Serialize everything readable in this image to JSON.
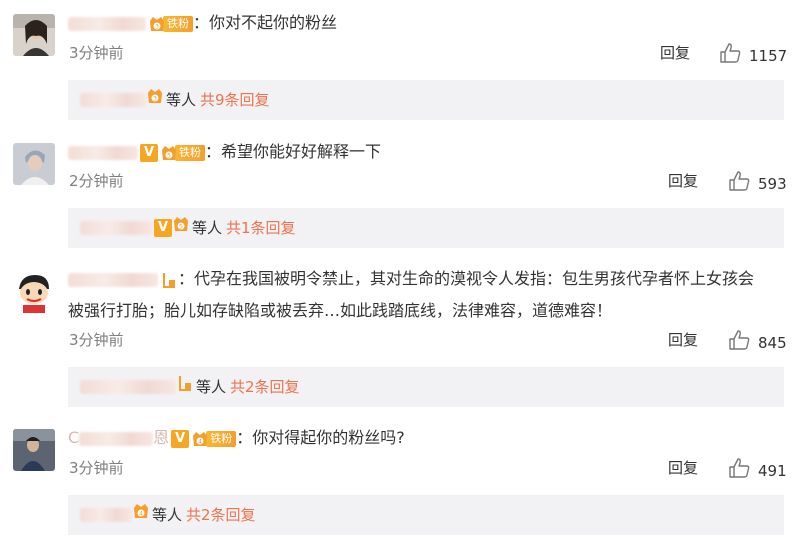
{
  "comments": [
    {
      "text": "：你对不起你的粉丝",
      "fan_tag": "铁粉",
      "time": "3分钟前",
      "reply_label": "回复",
      "likes": "1157",
      "sub_deng": "等人",
      "sub_count": "共9条回复"
    },
    {
      "text": "：希望你能好好解释一下",
      "fan_tag": "铁粉",
      "time": "2分钟前",
      "reply_label": "回复",
      "likes": "593",
      "sub_deng": "等人",
      "sub_count": "共1条回复"
    },
    {
      "text_line1": "：代孕在我国被明令禁止，其对生命的漠视令人发指：包生男孩代孕者怀上女孩会",
      "text_line2": "被强行打胎；胎儿如存缺陷或被丢弃…如此践踏底线，法律难容，道德难容！",
      "time": "3分钟前",
      "reply_label": "回复",
      "likes": "845",
      "sub_deng": "等人",
      "sub_count": "共2条回复"
    },
    {
      "name_prefix": "C",
      "name_suffix": "恩",
      "text": "：你对得起你的粉丝吗?",
      "fan_tag": "铁粉",
      "time": "3分钟前",
      "reply_label": "回复",
      "likes": "491",
      "sub_deng": "等人",
      "sub_count": "共2条回复"
    }
  ],
  "colors": {
    "link": "#eb7350",
    "muted": "#808080",
    "reply_bg": "#f2f2f5",
    "badge": "#f5a623"
  },
  "icons": {
    "like": "thumbs-up-icon",
    "crown": "crown-fan-icon",
    "verified": "verified-v-icon"
  }
}
